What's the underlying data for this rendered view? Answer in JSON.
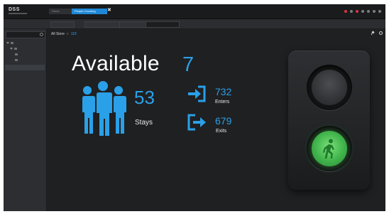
{
  "app": {
    "logo": "DSS",
    "tabs": [
      {
        "label": "Home"
      },
      {
        "label": "People Counting"
      }
    ],
    "close_symbol": "✖"
  },
  "breadcrumb": {
    "area": "All Store",
    "count": "118"
  },
  "counter": {
    "available_label": "Available",
    "available_value": "7",
    "stays_value": "53",
    "stays_label": "Stays",
    "enters_value": "732",
    "enters_label": "Enters",
    "exits_value": "679",
    "exits_label": "Exits"
  },
  "traffic_light": {
    "state": "green",
    "top_lamp": "off",
    "bottom_lamp": "on",
    "icon": "walking-person-icon"
  },
  "colors": {
    "accent": "#2aa0e8",
    "green_lamp": "#3fb34a",
    "background": "#1f2022"
  }
}
